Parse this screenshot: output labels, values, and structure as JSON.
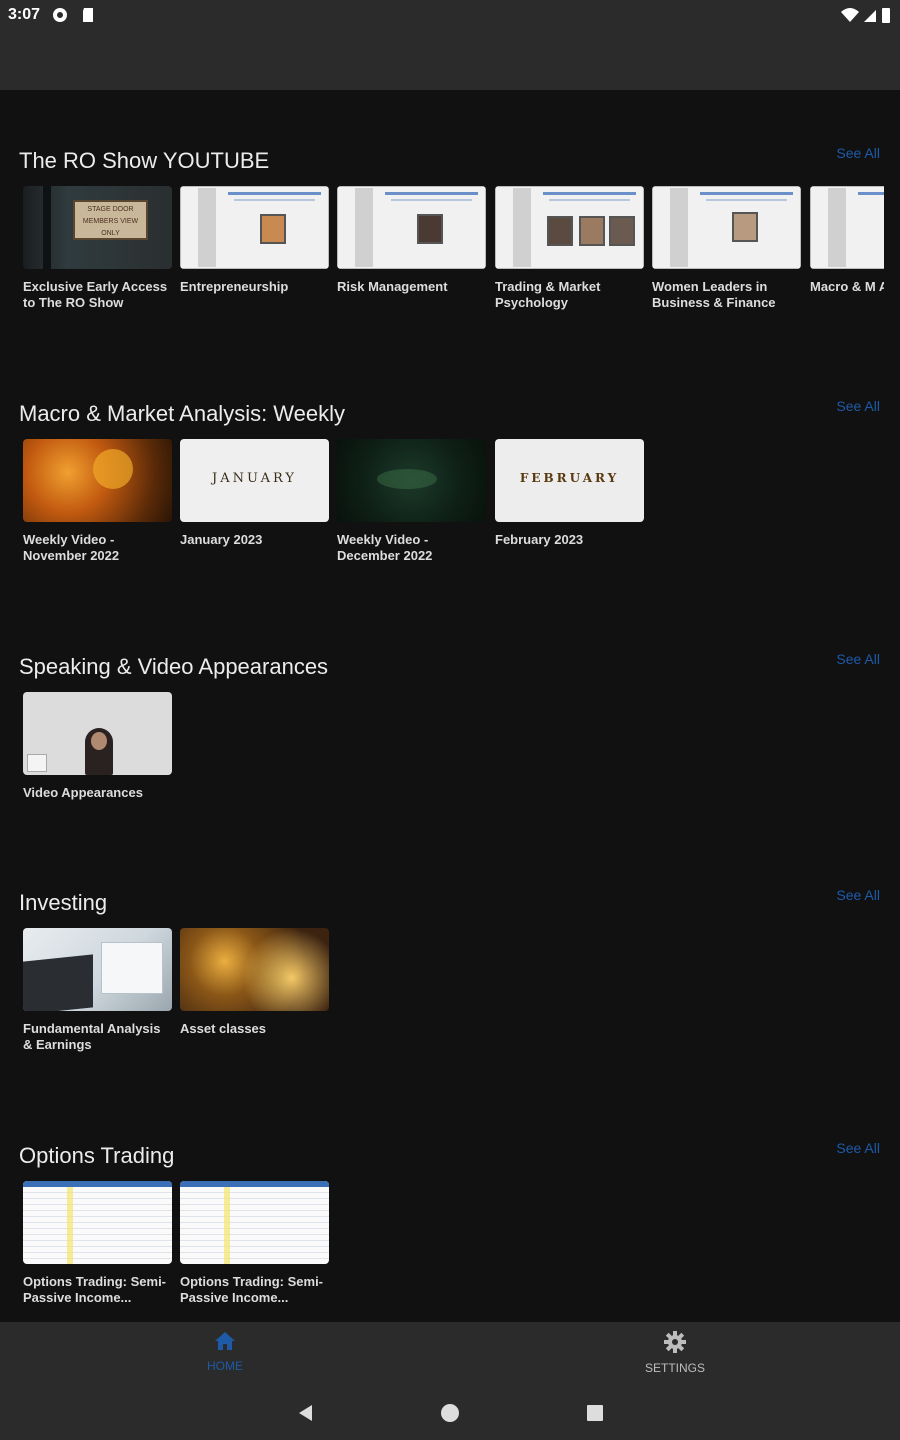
{
  "status_bar": {
    "time": "3:07"
  },
  "sections": [
    {
      "title": "The RO Show YOUTUBE",
      "see_all": "See All",
      "items": [
        {
          "caption": "Exclusive Early Access to The RO Show",
          "sign_text": "STAGE DOOR MEMBERS VIEW ONLY"
        },
        {
          "caption": "Entrepreneurship"
        },
        {
          "caption": "Risk Management"
        },
        {
          "caption": "Trading & Market Psychology"
        },
        {
          "caption": "Women Leaders in Business & Finance"
        },
        {
          "caption": "Macro & M Analysis"
        }
      ]
    },
    {
      "title": "Macro & Market Analysis: Weekly",
      "see_all": "See All",
      "items": [
        {
          "caption": "Weekly Video - November 2022"
        },
        {
          "caption": "January 2023",
          "tile_word": "JANUARY"
        },
        {
          "caption": "Weekly Video - December 2022"
        },
        {
          "caption": "February 2023",
          "tile_word": "FEBRUARY"
        }
      ]
    },
    {
      "title": "Speaking & Video Appearances",
      "see_all": "See All",
      "items": [
        {
          "caption": "Video Appearances"
        }
      ]
    },
    {
      "title": "Investing",
      "see_all": "See All",
      "items": [
        {
          "caption": "Fundamental Analysis & Earnings"
        },
        {
          "caption": "Asset classes"
        }
      ]
    },
    {
      "title": "Options Trading",
      "see_all": "See All",
      "items": [
        {
          "caption": "Options Trading: Semi-Passive Income..."
        },
        {
          "caption": "Options Trading: Semi-Passive Income..."
        }
      ]
    }
  ],
  "bottom_nav": {
    "home_label": "HOME",
    "settings_label": "SETTINGS",
    "active_color": "#1e5aa8",
    "inactive_color": "#bdbdbd"
  },
  "icons": [
    "home-icon",
    "gear-icon",
    "back-icon",
    "home-circle-icon",
    "recents-icon"
  ]
}
